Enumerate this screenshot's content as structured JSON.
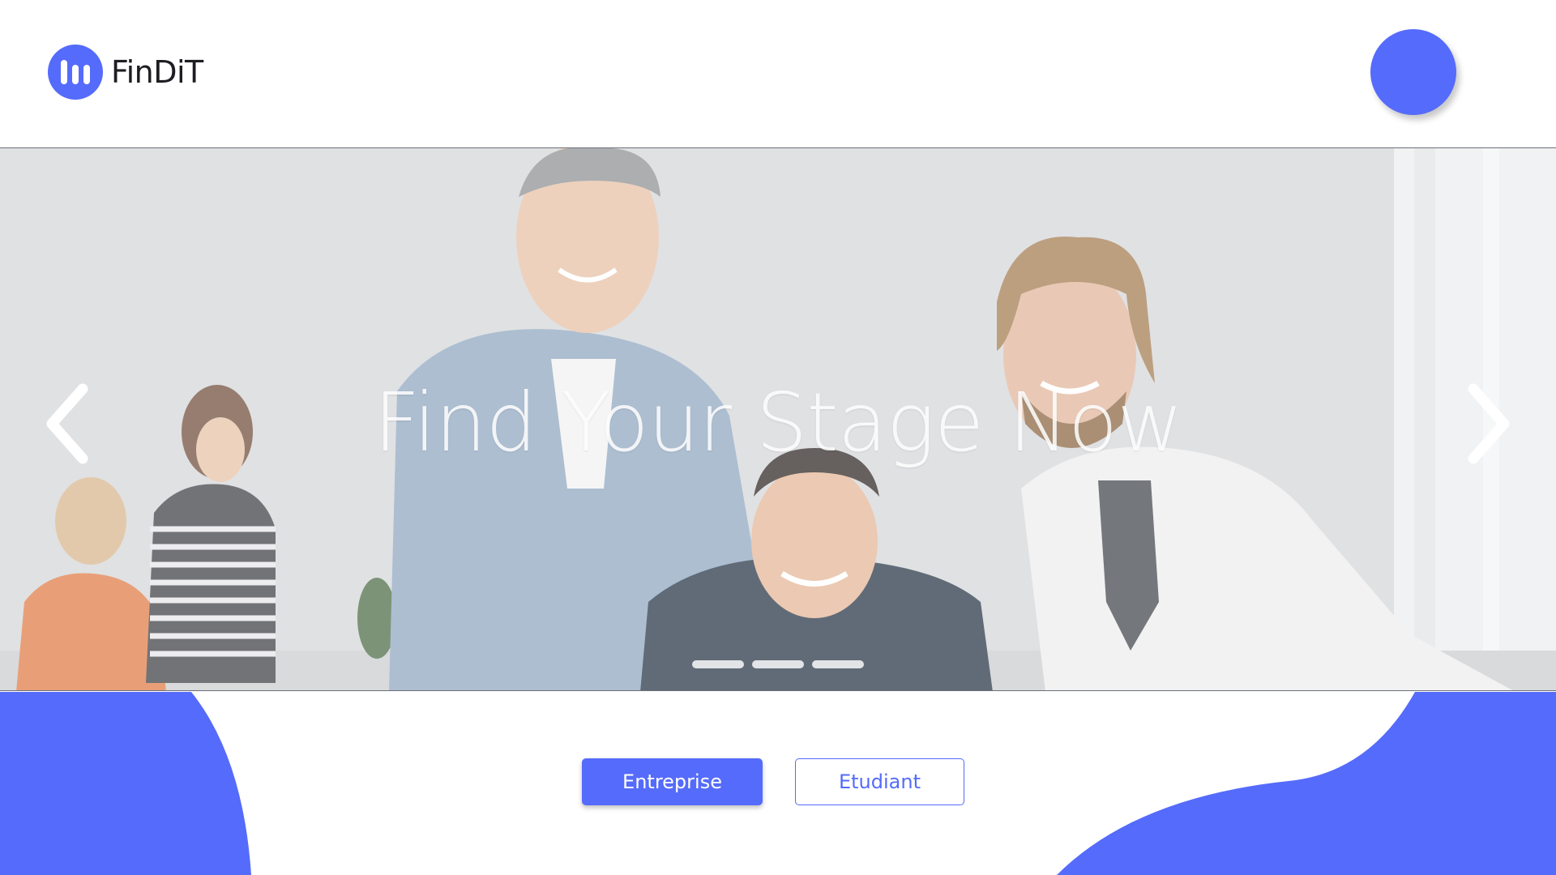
{
  "brand": {
    "name": "FinDiT",
    "color": "#556bfb",
    "logo_icon": "bars-icon"
  },
  "header": {
    "avatar_icon": "user-avatar"
  },
  "hero": {
    "title": "Find Your Stage Now",
    "prev_icon": "chevron-left-icon",
    "next_icon": "chevron-right-icon",
    "slide_count": 3,
    "active_slide": 1
  },
  "actions": {
    "entreprise_label": "Entreprise",
    "etudiant_label": "Etudiant"
  },
  "colors": {
    "accent": "#556bfb",
    "text_dark": "#1d1d22",
    "background": "#ffffff"
  }
}
